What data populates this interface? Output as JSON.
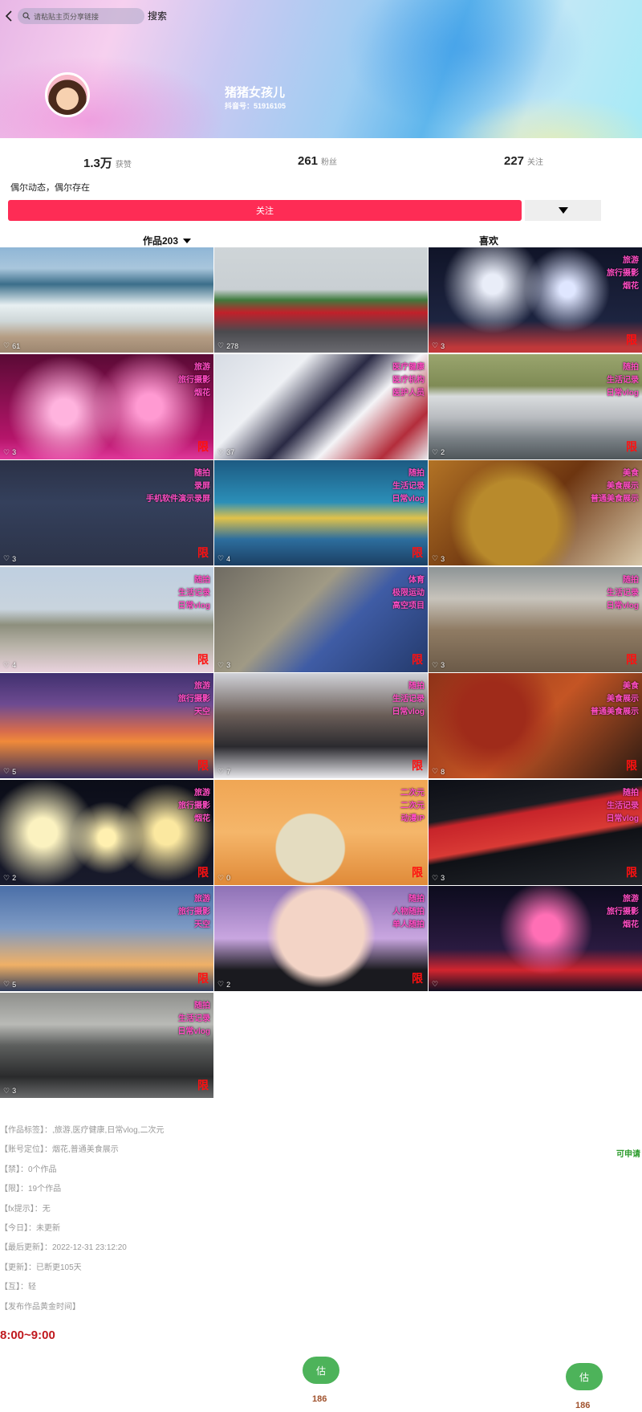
{
  "header": {
    "search_placeholder": "请粘贴主页分享链接",
    "search_button": "搜索",
    "nickname": "猪猪女孩儿",
    "douyin_id": "抖音号：51916105"
  },
  "stats": [
    {
      "num": "1.3万",
      "label": "获赞"
    },
    {
      "num": "261",
      "label": "粉丝"
    },
    {
      "num": "227",
      "label": "关注"
    }
  ],
  "bio": "偶尔动态，偶尔存在",
  "follow_label": "关注",
  "tabs": {
    "works": "作品203",
    "likes": "喜欢"
  },
  "grid": [
    {
      "likes": "61",
      "tags": [],
      "xian": "",
      "scene": "sea"
    },
    {
      "likes": "278",
      "tags": [],
      "xian": "",
      "scene": "street"
    },
    {
      "likes": "3",
      "tags": [
        "旅游",
        "旅行摄影",
        "烟花"
      ],
      "xian": "限",
      "scene": "fireworks-blue"
    },
    {
      "likes": "3",
      "tags": [
        "旅游",
        "旅行摄影",
        "烟花"
      ],
      "xian": "限",
      "scene": "fireworks-pink"
    },
    {
      "likes": "37",
      "tags": [
        "医疗健康",
        "医疗机构",
        "医护人员"
      ],
      "xian": "",
      "scene": "hospital"
    },
    {
      "likes": "2",
      "tags": [
        "随拍",
        "生活记录",
        "日常vlog"
      ],
      "xian": "限",
      "scene": "city"
    },
    {
      "likes": "3",
      "tags": [
        "随拍",
        "录屏",
        "手机软件演示录屏"
      ],
      "xian": "限",
      "scene": "weather"
    },
    {
      "likes": "4",
      "tags": [
        "随拍",
        "生活记录",
        "日常vlog"
      ],
      "xian": "限",
      "scene": "aquarium"
    },
    {
      "likes": "3",
      "tags": [
        "美食",
        "美食展示",
        "普通美食展示"
      ],
      "xian": "",
      "scene": "hotpot"
    },
    {
      "likes": "4",
      "tags": [
        "随拍",
        "生活记录",
        "日常vlog"
      ],
      "xian": "限",
      "scene": "wall"
    },
    {
      "likes": "3",
      "tags": [
        "体育",
        "极限运动",
        "高空项目"
      ],
      "xian": "限",
      "scene": "bike"
    },
    {
      "likes": "3",
      "tags": [
        "随拍",
        "生活记录",
        "日常vlog"
      ],
      "xian": "限",
      "scene": "terracotta"
    },
    {
      "likes": "5",
      "tags": [
        "旅游",
        "旅行摄影",
        "天空"
      ],
      "xian": "限",
      "scene": "sunset-plane"
    },
    {
      "likes": "7",
      "tags": [
        "随拍",
        "生活记录",
        "日常vlog"
      ],
      "xian": "限",
      "scene": "crowd"
    },
    {
      "likes": "8",
      "tags": [
        "美食",
        "美食展示",
        "普通美食展示"
      ],
      "xian": "限",
      "scene": "skewers"
    },
    {
      "likes": "2",
      "tags": [
        "旅游",
        "旅行摄影",
        "烟花"
      ],
      "xian": "限",
      "scene": "fireworks-gold"
    },
    {
      "likes": "0",
      "tags": [
        "二次元",
        "二次元",
        "动漫IP"
      ],
      "xian": "限",
      "scene": "cartoon"
    },
    {
      "likes": "3",
      "tags": [
        "随拍",
        "生活记录",
        "日常vlog"
      ],
      "xian": "限",
      "scene": "banner"
    },
    {
      "likes": "5",
      "tags": [
        "旅游",
        "旅行摄影",
        "天空"
      ],
      "xian": "限",
      "scene": "dusk"
    },
    {
      "likes": "2",
      "tags": [
        "随拍",
        "人物随拍",
        "单人随拍"
      ],
      "xian": "限",
      "scene": "girl"
    },
    {
      "likes": "",
      "tags": [
        "旅游",
        "旅行摄影",
        "烟花"
      ],
      "xian": "",
      "scene": "fireworks-river"
    },
    {
      "likes": "3",
      "tags": [
        "随拍",
        "生活记录",
        "日常vlog"
      ],
      "xian": "限",
      "scene": "car"
    }
  ],
  "info_lines": [
    "【作品标签】：,旅游,医疗健康,日常vlog,二次元",
    "【账号定位】：烟花,普通美食展示",
    "【禁】：0个作品",
    "【限】：19个作品",
    "【fx提示】：无",
    "【今日】：未更新",
    "【最后更新】：2022-12-31 23:12:20",
    "【更新】：已断更105天",
    "【互】：轻",
    "【发布作品黄金时间】"
  ],
  "apply_label": "可申请",
  "golden_time": "8:00~9:00",
  "estimates": [
    {
      "label": "估",
      "value": "186"
    },
    {
      "label": "估",
      "value": "186"
    }
  ]
}
